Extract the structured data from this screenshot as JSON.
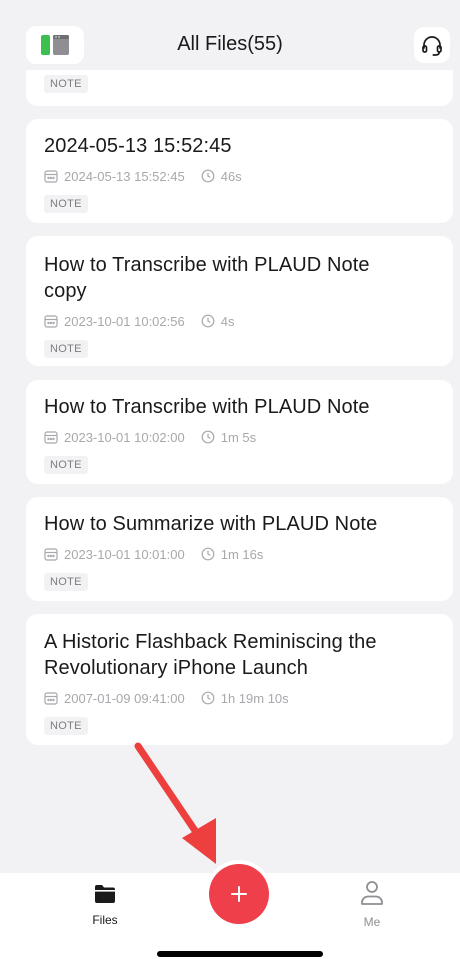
{
  "header": {
    "title": "All Files(55)"
  },
  "files": [
    {
      "title": "",
      "date": "",
      "duration": "",
      "tag": "NOTE"
    },
    {
      "title": "2024-05-13 15:52:45",
      "date": "2024-05-13 15:52:45",
      "duration": "46s",
      "tag": "NOTE"
    },
    {
      "title": "How to Transcribe with PLAUD Note copy",
      "date": "2023-10-01 10:02:56",
      "duration": "4s",
      "tag": "NOTE"
    },
    {
      "title": "How to Transcribe with PLAUD Note",
      "date": "2023-10-01 10:02:00",
      "duration": "1m 5s",
      "tag": "NOTE"
    },
    {
      "title": "How to Summarize with PLAUD Note",
      "date": "2023-10-01 10:01:00",
      "duration": "1m 16s",
      "tag": "NOTE"
    },
    {
      "title": "A Historic Flashback Reminiscing the Revolutionary iPhone Launch",
      "date": "2007-01-09 09:41:00",
      "duration": "1h 19m 10s",
      "tag": "NOTE"
    }
  ],
  "tabbar": {
    "files_label": "Files",
    "me_label": "Me"
  },
  "icons": {
    "sidebar": "sidebar-toggle-icon",
    "support": "headset-icon",
    "calendar": "calendar-icon",
    "clock": "clock-icon",
    "files_tab": "folder-icon",
    "me_tab": "person-icon",
    "add": "plus-icon",
    "annotation": "arrow-annotation"
  },
  "colors": {
    "accent": "#ee3f4b",
    "battery_green": "#3bbf4f",
    "background": "#f2f2f5",
    "meta_text": "#a8a8ad"
  }
}
